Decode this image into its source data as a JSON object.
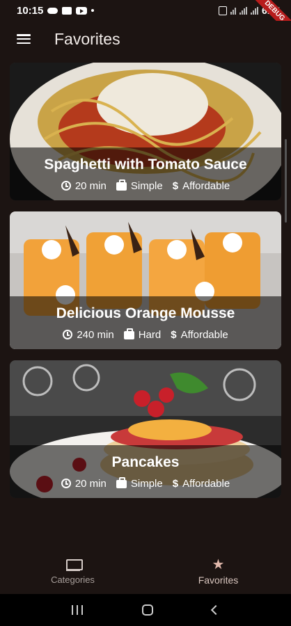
{
  "status_bar": {
    "time": "10:15",
    "battery": "61%",
    "debug_label": "DEBUG"
  },
  "app_bar": {
    "title": "Favorites"
  },
  "meals": [
    {
      "title": "Spaghetti with Tomato Sauce",
      "duration": "20 min",
      "complexity": "Simple",
      "affordability": "Affordable"
    },
    {
      "title": "Delicious Orange Mousse",
      "duration": "240 min",
      "complexity": "Hard",
      "affordability": "Affordable"
    },
    {
      "title": "Pancakes",
      "duration": "20 min",
      "complexity": "Simple",
      "affordability": "Affordable"
    }
  ],
  "bottom_nav": {
    "categories_label": "Categories",
    "favorites_label": "Favorites",
    "active": "favorites"
  },
  "colors": {
    "background": "#1c1412",
    "overlay": "rgba(0,0,0,0.55)",
    "active_tab": "#d9c6bf",
    "inactive_tab": "#a89f9b"
  }
}
